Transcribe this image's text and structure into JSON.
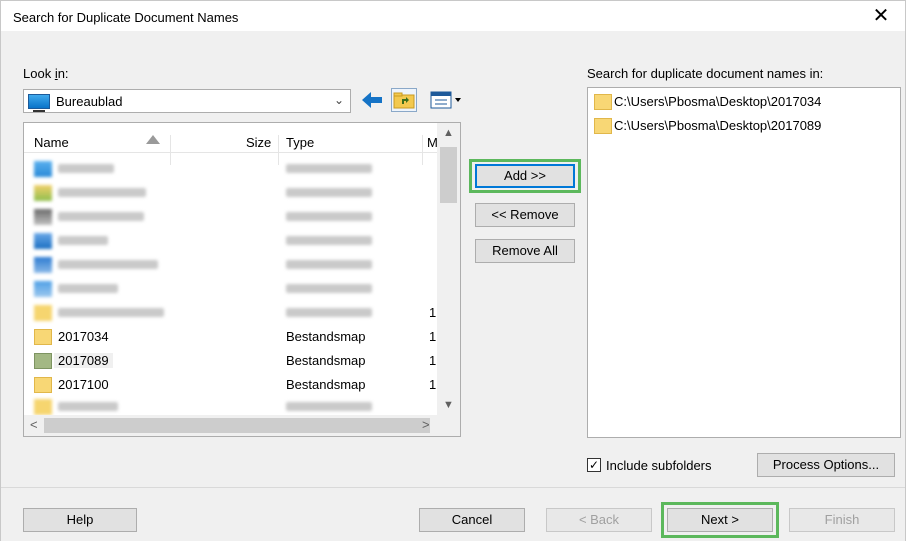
{
  "window": {
    "title": "Search for Duplicate Document Names",
    "close_icon": "close-icon"
  },
  "left_panel": {
    "look_in_label": "Look in:",
    "look_in_value": "Bureaublad",
    "columns": [
      "Name",
      "Size",
      "Type",
      "M"
    ],
    "rows": [
      {
        "name": "",
        "type": "",
        "modified": "",
        "blurred": true
      },
      {
        "name": "",
        "type": "",
        "modified": "",
        "blurred": true
      },
      {
        "name": "",
        "type": "",
        "modified": "",
        "blurred": true
      },
      {
        "name": "",
        "type": "",
        "modified": "",
        "blurred": true
      },
      {
        "name": "",
        "type": "",
        "modified": "",
        "blurred": true
      },
      {
        "name": "",
        "type": "",
        "modified": "",
        "blurred": true
      },
      {
        "name": "",
        "type": "",
        "modified": "1",
        "blurred": true
      },
      {
        "name": "2017034",
        "type": "Bestandsmap",
        "modified": "1",
        "blurred": false
      },
      {
        "name": "2017089",
        "type": "Bestandsmap",
        "modified": "1",
        "blurred": false,
        "selected": true
      },
      {
        "name": "2017100",
        "type": "Bestandsmap",
        "modified": "1",
        "blurred": false
      },
      {
        "name": "",
        "type": "",
        "modified": "",
        "blurred": true
      }
    ]
  },
  "middle": {
    "add_label": "Add >>",
    "remove_label": "<< Remove",
    "remove_all_label": "Remove All"
  },
  "right_panel": {
    "label": "Search for duplicate document names in:",
    "paths": [
      "C:\\Users\\Pbosma\\Desktop\\2017034",
      "C:\\Users\\Pbosma\\Desktop\\2017089"
    ],
    "include_subfolders_label": "Include subfolders",
    "include_subfolders_checked": true,
    "process_options_label": "Process Options..."
  },
  "footer": {
    "help_label": "Help",
    "cancel_label": "Cancel",
    "back_label": "< Back",
    "next_label": "Next >",
    "finish_label": "Finish"
  },
  "colors": {
    "highlight": "#5cb85c",
    "folder": "#f8d775",
    "accent": "#0078d7"
  }
}
